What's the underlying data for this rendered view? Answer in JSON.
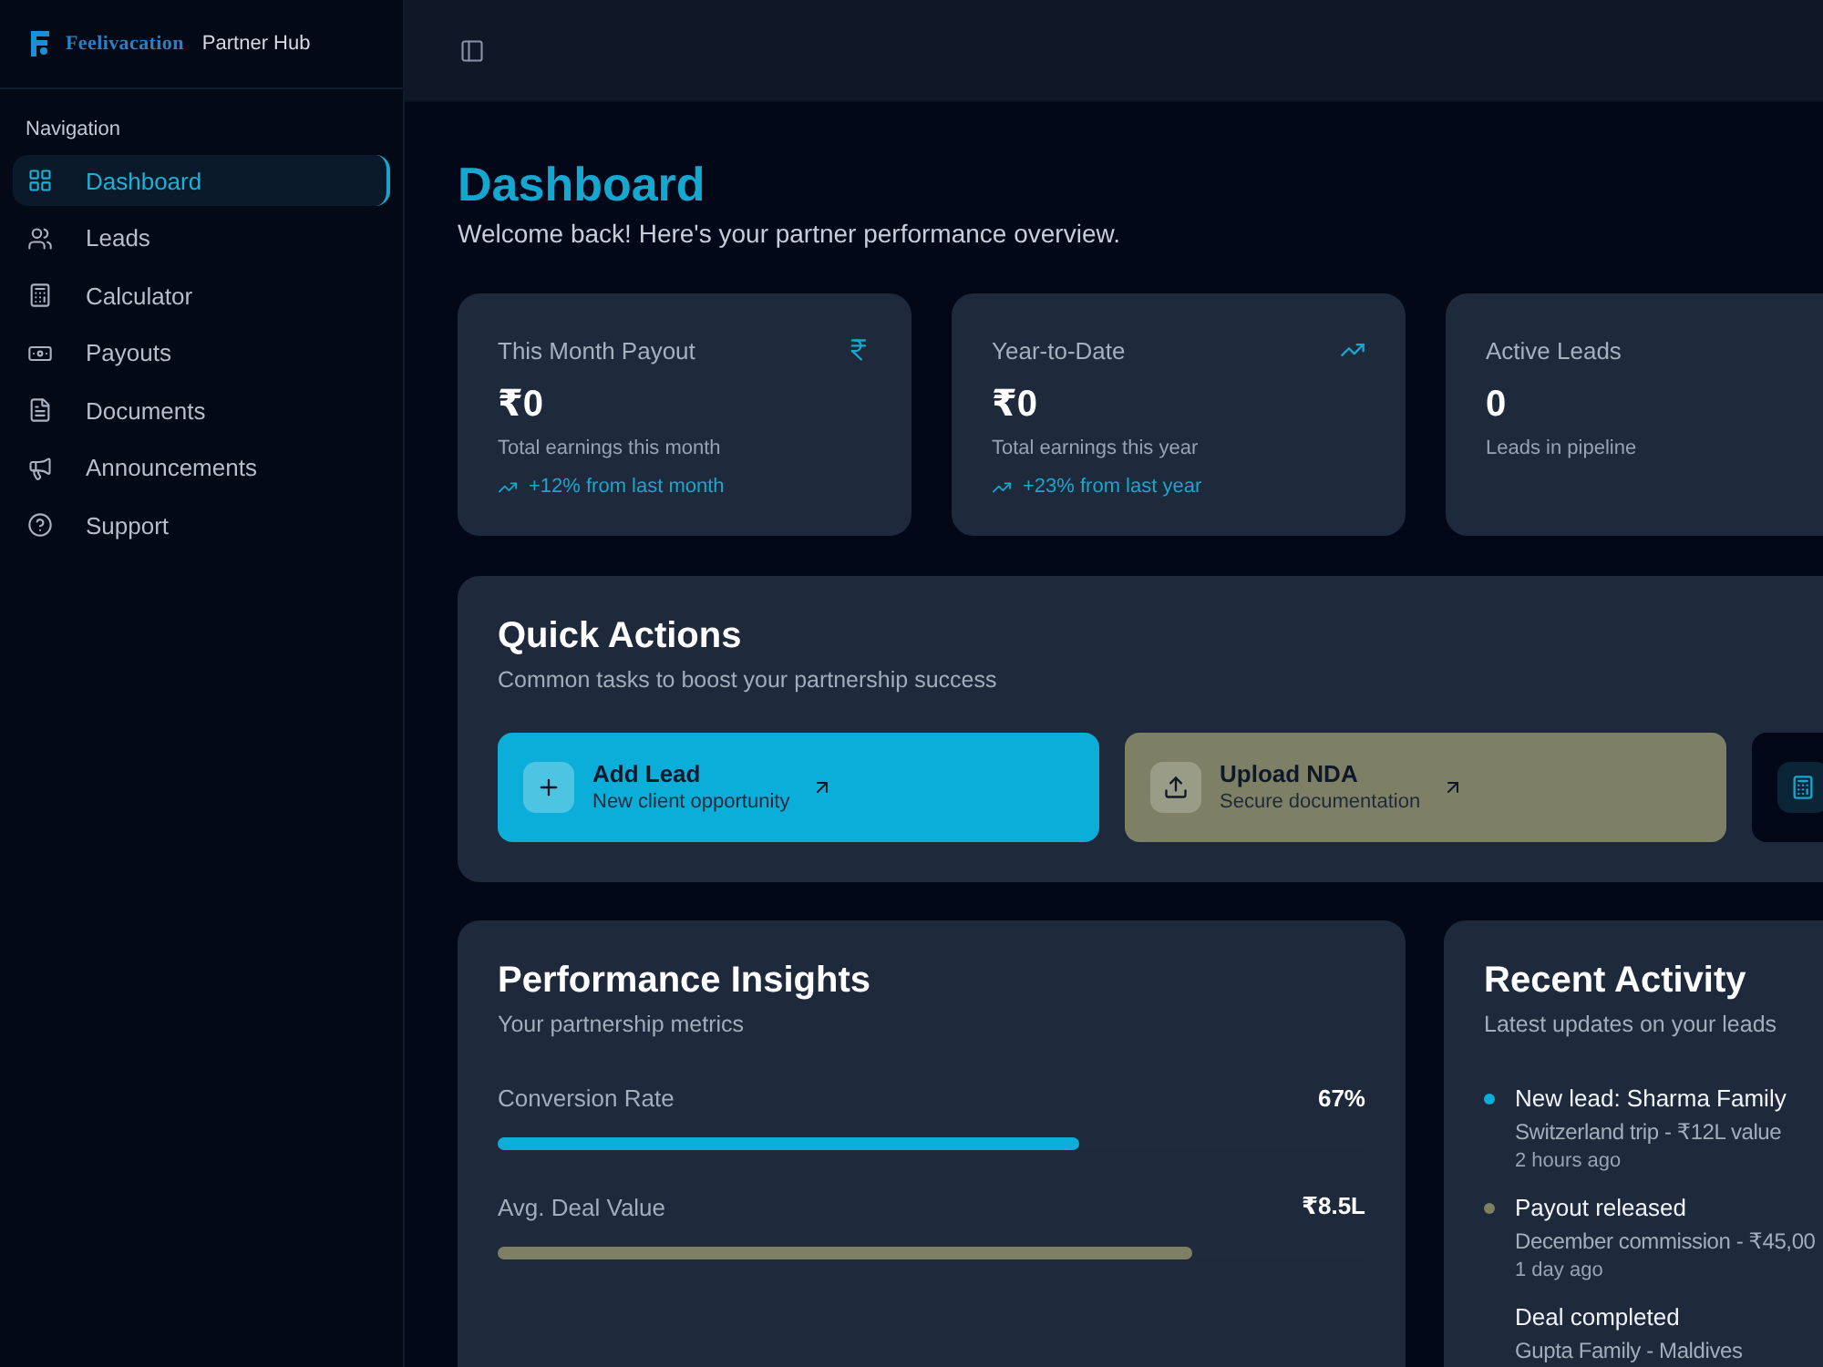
{
  "sidebar": {
    "brand": {
      "logo_text": "Feelivacation",
      "app_name": "Partner Hub"
    },
    "section_label": "Navigation",
    "items": [
      {
        "label": "Dashboard",
        "selected": true
      },
      {
        "label": "Leads",
        "selected": false
      },
      {
        "label": "Calculator",
        "selected": false
      },
      {
        "label": "Payouts",
        "selected": false
      },
      {
        "label": "Documents",
        "selected": false
      },
      {
        "label": "Announcements",
        "selected": false
      },
      {
        "label": "Support",
        "selected": false
      }
    ]
  },
  "page": {
    "title": "Dashboard",
    "subtitle": "Welcome back! Here's your partner performance overview."
  },
  "stats": [
    {
      "label": "This Month Payout",
      "value": "₹0",
      "caption": "Total earnings this month",
      "trend": "+12% from last month"
    },
    {
      "label": "Year-to-Date",
      "value": "₹0",
      "caption": "Total earnings this year",
      "trend": "+23% from last year"
    },
    {
      "label": "Active Leads",
      "value": "0",
      "caption": "Leads in pipeline"
    }
  ],
  "quick_actions": {
    "title": "Quick Actions",
    "subtitle": "Common tasks to boost your partnership success",
    "actions": [
      {
        "kind": "primary",
        "title": "Add Lead",
        "subtitle": "New client opportunity"
      },
      {
        "kind": "secondary",
        "title": "Upload NDA",
        "subtitle": "Secure documentation"
      },
      {
        "kind": "dark"
      }
    ]
  },
  "performance": {
    "title": "Performance Insights",
    "subtitle": "Your partnership metrics",
    "metrics": [
      {
        "label": "Conversion Rate",
        "value": "67%",
        "level": 0.67,
        "color": "#0aaed9"
      },
      {
        "label": "Avg. Deal Value",
        "value": "₹8.5L",
        "level": 0.8,
        "color": "#7d8064"
      }
    ]
  },
  "activity": {
    "title": "Recent Activity",
    "subtitle": "Latest updates on your leads",
    "items": [
      {
        "title": "New lead: Sharma Family",
        "detail": "Switzerland trip - ₹12L value",
        "time": "2 hours ago",
        "color": "#0aaed9"
      },
      {
        "title": "Payout released",
        "detail": "December commission - ₹45,00",
        "time": "1 day ago",
        "color": "#7d8064"
      },
      {
        "title": "Deal completed",
        "detail": "Gupta Family - Maldives"
      }
    ]
  }
}
